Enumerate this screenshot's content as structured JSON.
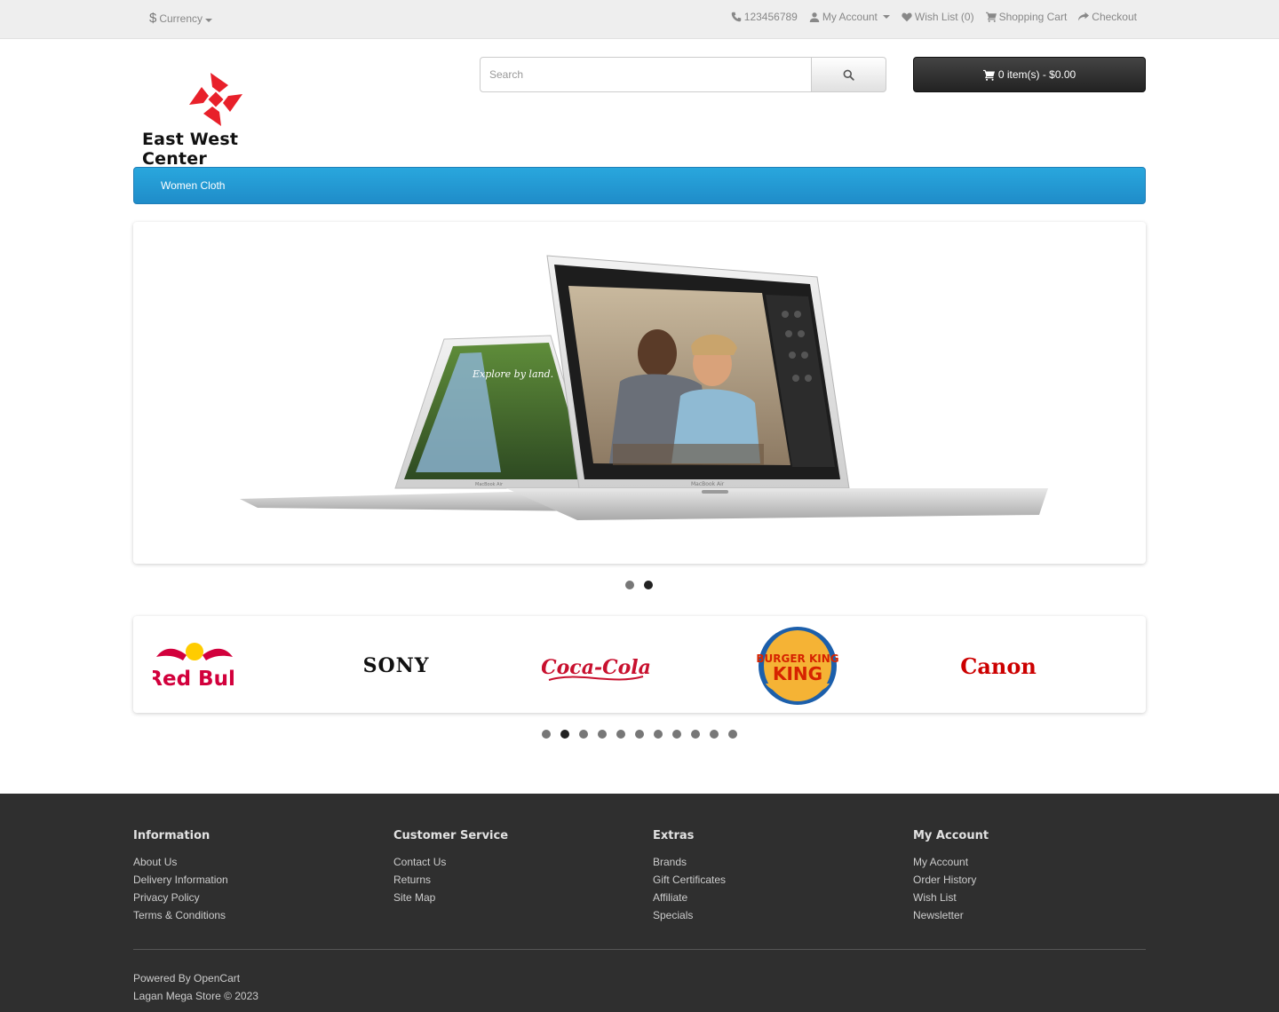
{
  "topbar": {
    "currency_symbol": "$",
    "currency_label": "Currency",
    "phone": "123456789",
    "my_account": "My Account",
    "wish_list": "Wish List (0)",
    "shopping_cart": "Shopping Cart",
    "checkout": "Checkout"
  },
  "header": {
    "logo_text": "East West Center",
    "search_placeholder": "Search",
    "cart_label": "0 item(s) - $0.00"
  },
  "menu": {
    "items": [
      "Women Cloth"
    ]
  },
  "slideshow": {
    "screen_text": "Explore by land.",
    "model_label": "MacBook Air",
    "dots": [
      {
        "active": false
      },
      {
        "active": true
      }
    ]
  },
  "brands": {
    "items": [
      {
        "name": "Red Bull",
        "color": "#d2003c"
      },
      {
        "name": "SONY",
        "color": "#111111"
      },
      {
        "name": "Coca-Cola",
        "color": "#c8102e"
      },
      {
        "name": "BURGER KING",
        "color": "#d62300"
      },
      {
        "name": "Canon",
        "color": "#cc0000"
      }
    ],
    "dots_count": 11,
    "active_dot": 1
  },
  "footer": {
    "columns": [
      {
        "title": "Information",
        "links": [
          "About Us",
          "Delivery Information",
          "Privacy Policy",
          "Terms & Conditions"
        ]
      },
      {
        "title": "Customer Service",
        "links": [
          "Contact Us",
          "Returns",
          "Site Map"
        ]
      },
      {
        "title": "Extras",
        "links": [
          "Brands",
          "Gift Certificates",
          "Affiliate",
          "Specials"
        ]
      },
      {
        "title": "My Account",
        "links": [
          "My Account",
          "Order History",
          "Wish List",
          "Newsletter"
        ]
      }
    ],
    "powered_prefix": "Powered By",
    "powered_link": "OpenCart",
    "copyright": "Lagan Mega Store © 2023"
  },
  "colors": {
    "menu_blue": "#229ac8",
    "footer_bg": "#2f2f2f",
    "logo_red": "#e8202a"
  }
}
